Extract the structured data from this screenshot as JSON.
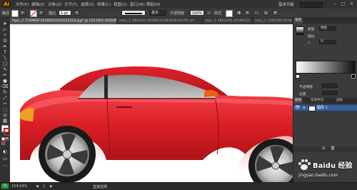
{
  "app": {
    "logo_text": "Ai"
  },
  "menubar": {
    "items": [
      "文件(F)",
      "编辑(E)",
      "对象(O)",
      "文字(T)",
      "选择(S)",
      "效果(C)",
      "视图(V)",
      "窗口(W)",
      "帮助(H)"
    ],
    "workspace_label": "基本功能",
    "window_controls": [
      "–",
      "□",
      "✕"
    ]
  },
  "controlbar": {
    "selection_label": "路径",
    "fill_color": "#ffffff",
    "stroke_color": "#c41f1f",
    "stroke_label": "描边",
    "stroke_preset": "基本",
    "opacity_label": "不透明度",
    "opacity_value": "100%",
    "style_label": "样式",
    "width_value": "1 pt"
  },
  "tabs": [
    {
      "label": "hipic_2 7149969 20180201016152418.jpg* @ 154.04% (RGB/预览)",
      "active": true
    },
    {
      "label": "hipic_1 1822022 20180125183016163707.ai*",
      "active": false
    },
    {
      "label": "hipic_1 1821259 20180125...",
      "active": false
    },
    {
      "label": "hipic_2 7262799 20180...",
      "active": false
    }
  ],
  "tools": {
    "icons": [
      "selection-tool-icon",
      "direct-selection-tool-icon",
      "magic-wand-tool-icon",
      "lasso-tool-icon",
      "pen-tool-icon",
      "type-tool-icon",
      "line-tool-icon",
      "rectangle-tool-icon",
      "paintbrush-tool-icon",
      "pencil-tool-icon",
      "blob-brush-tool-icon",
      "eraser-tool-icon",
      "rotate-tool-icon",
      "scale-tool-icon",
      "width-tool-icon",
      "free-transform-tool-icon",
      "shape-builder-tool-icon",
      "perspective-grid-tool-icon",
      "mesh-tool-icon",
      "gradient-tool-icon",
      "eyedropper-tool-icon",
      "blend-tool-icon",
      "symbol-sprayer-tool-icon",
      "column-graph-tool-icon",
      "artboard-tool-icon",
      "slice-tool-icon",
      "hand-tool-icon",
      "zoom-tool-icon"
    ],
    "glyphs": [
      "➤",
      "▷",
      "✧",
      "ʘ",
      "✒",
      "T",
      "╲",
      "□",
      "✎",
      "✏",
      "●",
      "⌫",
      "↻",
      "⤢",
      "⇿",
      "⬚",
      "◎",
      "▦",
      "▥",
      "◧",
      "✜",
      "∞",
      "✺",
      "▮",
      "▭",
      "⌗",
      "✋",
      "🔍"
    ],
    "fill_color": "#ffffff",
    "stroke_color": "#c41f1f"
  },
  "right_panel": {
    "gradient": {
      "tab_label": "渐变",
      "type_label": "类型",
      "type_value": "线性",
      "stroke_label": "描边",
      "angle_label": "△",
      "angle_value": "0°"
    },
    "stroke_panel": {
      "opacity_label": "不透明度",
      "location_label": "位置"
    },
    "layers": {
      "tabs": [
        "图层",
        "资源导出",
        "画板"
      ],
      "layer_name": "图层 1"
    }
  },
  "statusbar": {
    "zoom": "154.04%",
    "page": "1",
    "tool_name": "直接选择"
  },
  "watermark": {
    "text": "Baidu 经验",
    "url": "jingyan.baidu.com"
  },
  "colors": {
    "car_body": "#d81e24",
    "car_body_dark": "#9e0f14",
    "window_glass": "#a6a6a6",
    "headlight": "#f0a020",
    "rim": "#cfcfcf"
  }
}
